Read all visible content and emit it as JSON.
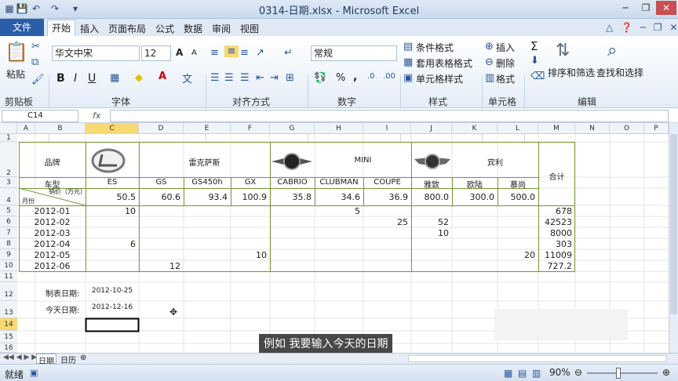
{
  "window": {
    "title": "0314-日期.xlsx - Microsoft Excel"
  },
  "tabs": [
    "文件",
    "开始",
    "插入",
    "页面布局",
    "公式",
    "数据",
    "审阅",
    "视图"
  ],
  "ribbon": {
    "clipboard": {
      "group": "剪贴板",
      "paste": "粘贴"
    },
    "font": {
      "group": "字体",
      "name": "华文中宋",
      "size": "12",
      "bold": "B",
      "italic": "I",
      "underline": "U",
      "grow": "A",
      "shrink": "A"
    },
    "align": {
      "group": "对齐方式"
    },
    "number": {
      "group": "数字",
      "format": "常规",
      "percent": "%",
      "comma": ","
    },
    "styles": {
      "group": "样式",
      "cond": "条件格式",
      "table": "套用表格格式",
      "cell": "单元格样式"
    },
    "cells": {
      "group": "单元格",
      "insert": "插入",
      "delete": "删除",
      "format": "格式"
    },
    "edit": {
      "group": "编辑",
      "sum": "Σ",
      "sort": "排序和筛选",
      "find": "查找和选择"
    }
  },
  "formula_bar": {
    "name_box": "C14",
    "fx": "fx",
    "value": ""
  },
  "columns": [
    "A",
    "B",
    "C",
    "D",
    "E",
    "F",
    "G",
    "H",
    "I",
    "J",
    "K",
    "L",
    "M",
    "N",
    "O",
    "P"
  ],
  "rows": [
    "1",
    "2",
    "3",
    "4",
    "5",
    "6",
    "7",
    "8",
    "9",
    "10",
    "11",
    "12",
    "13",
    "14",
    "15",
    "16"
  ],
  "sheet": {
    "brand_label": "品牌",
    "lexus": "雷克萨斯",
    "mini": "MINI",
    "bentley": "宾利",
    "total": "合计",
    "model_label": "车型",
    "sales_label": "销价（万元）",
    "month_label": "月份",
    "models": [
      "ES",
      "GS",
      "GS450h",
      "GX",
      "CABRIO",
      "CLUBMAN",
      "COUPE",
      "雅致",
      "欧陆",
      "慕尚"
    ],
    "prices": [
      "50.5",
      "60.6",
      "93.4",
      "100.9",
      "35.8",
      "34.6",
      "36.9",
      "800.0",
      "300.0",
      "500.0"
    ],
    "months": [
      "2012-01",
      "2012-02",
      "2012-03",
      "2012-04",
      "2012-05",
      "2012-06"
    ],
    "data": [
      [
        "10",
        "",
        "",
        "",
        "",
        "5",
        "",
        "",
        "",
        "",
        "678"
      ],
      [
        "",
        "",
        "",
        "",
        "",
        "",
        "25",
        "52",
        "",
        "",
        "42523"
      ],
      [
        "",
        "",
        "",
        "",
        "",
        "",
        "",
        "10",
        "",
        "",
        "8000"
      ],
      [
        "6",
        "",
        "",
        "",
        "",
        "",
        "",
        "",
        "",
        "",
        "303"
      ],
      [
        "",
        "",
        "",
        "10",
        "",
        "",
        "",
        "",
        "",
        "20",
        "11009"
      ],
      [
        "",
        "12",
        "",
        "",
        "",
        "",
        "",
        "",
        "",
        "",
        "727.2"
      ]
    ],
    "made_date_label": "制表日期:",
    "made_date": "2012-10-25",
    "today_label": "今天日期:",
    "today": "2012-12-16"
  },
  "sheet_tabs": [
    "日期",
    "日历"
  ],
  "status": {
    "ready": "就绪",
    "zoom": "90%"
  },
  "subtitle": "例如  我要输入今天的日期"
}
